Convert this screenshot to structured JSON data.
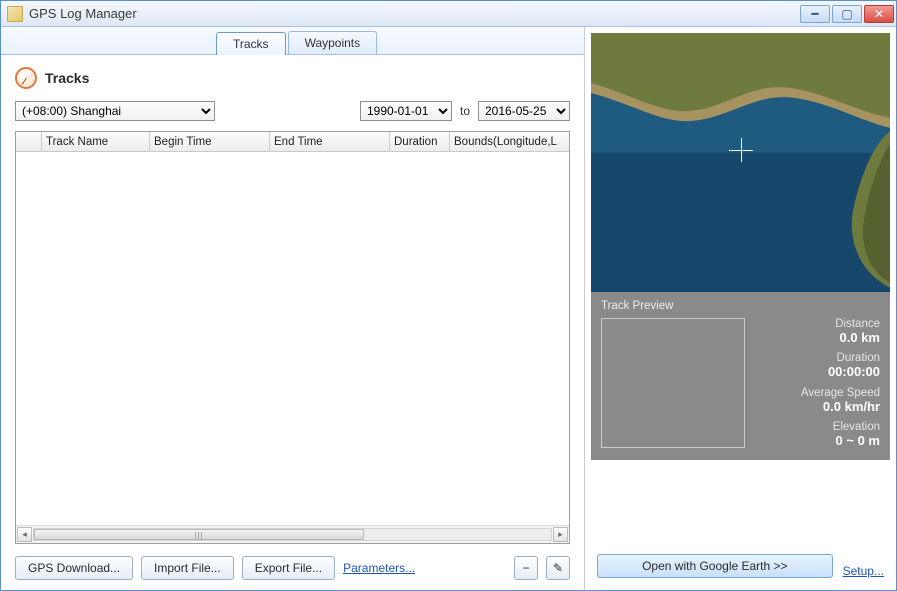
{
  "window": {
    "title": "GPS Log Manager"
  },
  "tabs": {
    "tracks": "Tracks",
    "waypoints": "Waypoints"
  },
  "section": {
    "title": "Tracks"
  },
  "filters": {
    "timezone_selected": "(+08:00) Shanghai",
    "from_date": "1990-01-01",
    "to_label": "to",
    "to_date": "2016-05-25"
  },
  "columns": {
    "check": "",
    "name": "Track Name",
    "begin": "Begin Time",
    "end": "End Time",
    "duration": "Duration",
    "bounds": "Bounds(Longitude,L"
  },
  "buttons": {
    "gps_download": "GPS Download...",
    "import_file": "Import File...",
    "export_file": "Export File...",
    "parameters": "Parameters...",
    "minus": "−",
    "edit": "✎"
  },
  "preview": {
    "label": "Track Preview",
    "stats": {
      "distance_label": "Distance",
      "distance_value": "0.0 km",
      "duration_label": "Duration",
      "duration_value": "00:00:00",
      "avgspeed_label": "Average Speed",
      "avgspeed_value": "0.0 km/hr",
      "elevation_label": "Elevation",
      "elevation_value": "0 ~ 0 m"
    }
  },
  "right": {
    "google_earth": "Open with Google Earth >>",
    "setup": "Setup..."
  }
}
